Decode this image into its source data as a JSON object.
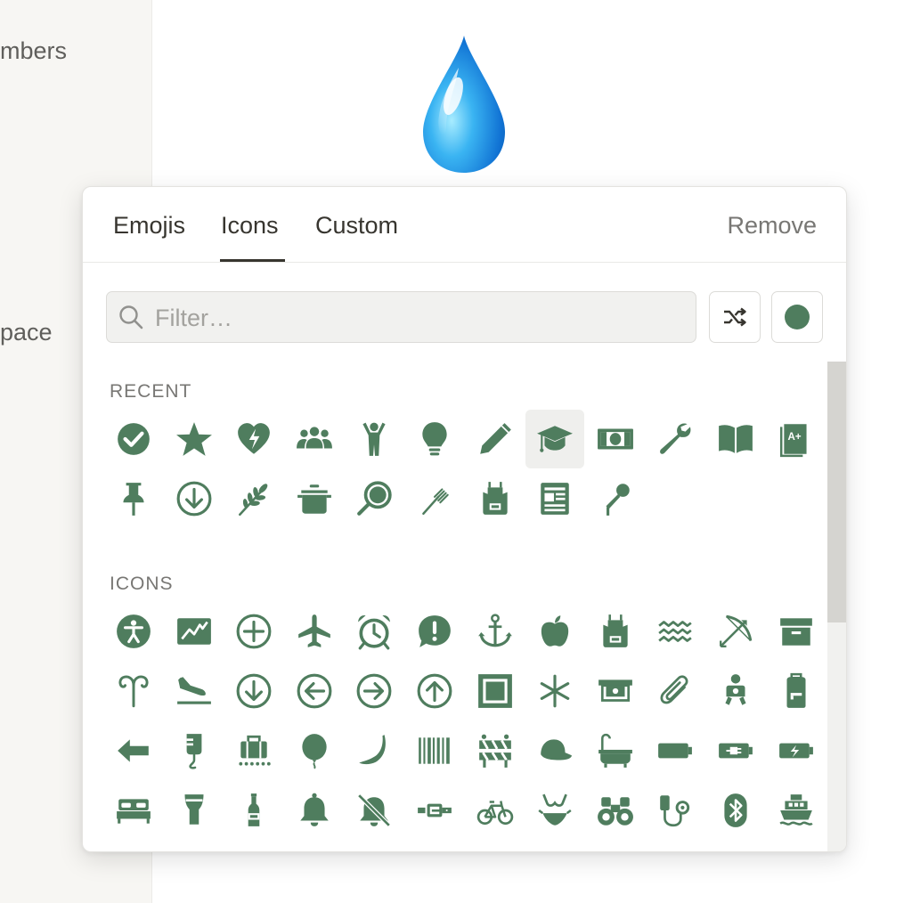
{
  "sidebar": {
    "items": [
      "mbers",
      "pace"
    ]
  },
  "picker": {
    "tabs": [
      "Emojis",
      "Icons",
      "Custom"
    ],
    "active_tab": "Icons",
    "remove_label": "Remove",
    "filter": {
      "placeholder": "Filter…",
      "value": ""
    },
    "selected_color": "#4f7d5e",
    "sections": [
      {
        "label": "RECENT",
        "icons": [
          "check-circle",
          "star",
          "heart-pulse",
          "group",
          "person-arms-up",
          "lightbulb",
          "pencil",
          "graduation-cap",
          "money",
          "wrench",
          "book-open",
          "report-card",
          "pushpin",
          "arrow-down-circle",
          "wheat",
          "pot",
          "frying-pan",
          "fork",
          "apron",
          "newspaper",
          "microphone"
        ]
      },
      {
        "label": "ICONS",
        "icons": [
          "accessibility",
          "chart-line",
          "plus-circle",
          "airplane",
          "alarm-clock",
          "exclamation-bubble",
          "anchor",
          "apple",
          "apron",
          "aquarius",
          "archery",
          "archive",
          "aries",
          "airplane-arrival",
          "arrow-down-circle",
          "arrow-left-circle",
          "arrow-right-circle",
          "arrow-up-circle",
          "artwork-frame",
          "asterisk",
          "atm",
          "paperclip",
          "baby",
          "backpack",
          "arrow-left",
          "iv-bag",
          "baggage-claim",
          "balloon",
          "banana",
          "barcode",
          "barricade",
          "baseball-cap",
          "bathtub",
          "battery-full",
          "battery-charging-plug",
          "battery-charging-bolt",
          "bed",
          "beer",
          "bottle",
          "bell",
          "bell-slash",
          "belt",
          "bicycle",
          "bikini",
          "binoculars",
          "blood-pressure",
          "bluetooth",
          "boat"
        ]
      }
    ]
  }
}
